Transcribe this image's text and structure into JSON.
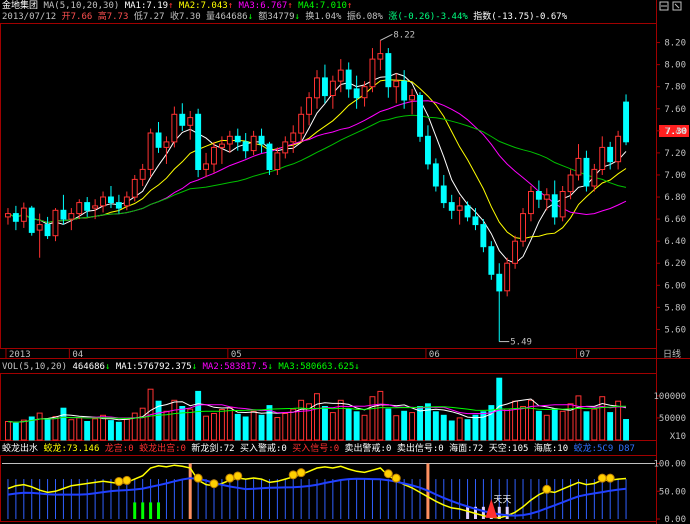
{
  "stock": {
    "name": "金地集团",
    "ma_label": "MA(5,10,20,30)",
    "ma1": "MA1:7.19",
    "ma2": "MA2:7.043",
    "ma3": "MA3:6.767",
    "ma4": "MA4:7.010"
  },
  "quote": {
    "date": "2013/07/12",
    "open": "开7.66",
    "high": "高7.73",
    "low": "低7.27",
    "close": "收7.30",
    "volume": "量464686",
    "amount": "额34779",
    "turnover": "换1.04%",
    "amplitude": "振6.08%",
    "change": "涨(-0.26)-3.44%",
    "index": "指数(-13.75)-0.67%"
  },
  "price_axis": {
    "ticks": [
      "8.20",
      "8.00",
      "7.80",
      "7.60",
      "7.40",
      "7.20",
      "7.00",
      "6.80",
      "6.60",
      "6.40",
      "6.20",
      "6.00",
      "5.80",
      "5.60"
    ],
    "current": "7.30",
    "high_marker": "8.22",
    "low_marker": "5.49"
  },
  "date_axis": {
    "labels": [
      "2013",
      "04",
      "05",
      "06",
      "07"
    ],
    "unit_label": "日线"
  },
  "volume_panel": {
    "title": "VOL(5,10,20)",
    "value": "464686",
    "ma1": "MA1:576792.375",
    "ma2": "MA2:583817.5",
    "ma3": "MA3:580663.625",
    "ticks": [
      "100000",
      "50000",
      "X10"
    ]
  },
  "indicator_panel": {
    "name": "蛟龙出水",
    "jiaolong": "蛟龙:73.146",
    "longgong": "龙宫:0",
    "jiaolong_chugong": "蛟龙出宫:0",
    "xinlongjian": "新龙剑:72",
    "buy_warning": "买入警戒:0",
    "buy_signal": "买入信号:0",
    "sell_warning": "卖出警戒:0",
    "sell_signal": "卖出信号:0",
    "haimian": "海面:72",
    "tiankong": "天空:105",
    "haidi": "海底:10",
    "jiaolong2": "蛟龙:5C9 D87",
    "ticks": [
      "100.00",
      "50.00",
      "0.00"
    ],
    "flag_text": "天天"
  },
  "chart_data": {
    "type": "candlestick",
    "ylim": [
      5.45,
      8.35
    ],
    "candles": [
      [
        6.62,
        6.7,
        6.55,
        6.65
      ],
      [
        6.65,
        6.72,
        6.5,
        6.58
      ],
      [
        6.58,
        6.75,
        6.52,
        6.7
      ],
      [
        6.7,
        6.72,
        6.45,
        6.48
      ],
      [
        6.5,
        6.65,
        6.25,
        6.55
      ],
      [
        6.55,
        6.62,
        6.42,
        6.45
      ],
      [
        6.45,
        6.7,
        6.4,
        6.68
      ],
      [
        6.68,
        6.82,
        6.55,
        6.6
      ],
      [
        6.6,
        6.7,
        6.5,
        6.65
      ],
      [
        6.65,
        6.78,
        6.6,
        6.75
      ],
      [
        6.75,
        6.8,
        6.62,
        6.68
      ],
      [
        6.7,
        6.78,
        6.6,
        6.72
      ],
      [
        6.72,
        6.85,
        6.66,
        6.8
      ],
      [
        6.8,
        6.9,
        6.7,
        6.75
      ],
      [
        6.75,
        6.82,
        6.65,
        6.7
      ],
      [
        6.72,
        6.85,
        6.68,
        6.8
      ],
      [
        6.8,
        7.0,
        6.76,
        6.96
      ],
      [
        6.96,
        7.1,
        6.9,
        7.05
      ],
      [
        7.05,
        7.42,
        6.98,
        7.38
      ],
      [
        7.38,
        7.48,
        7.2,
        7.25
      ],
      [
        7.25,
        7.35,
        7.1,
        7.3
      ],
      [
        7.3,
        7.62,
        7.25,
        7.55
      ],
      [
        7.55,
        7.65,
        7.4,
        7.45
      ],
      [
        7.45,
        7.58,
        7.32,
        7.52
      ],
      [
        7.55,
        7.6,
        6.98,
        7.05
      ],
      [
        7.05,
        7.2,
        6.98,
        7.1
      ],
      [
        7.1,
        7.3,
        7.02,
        7.25
      ],
      [
        7.25,
        7.35,
        7.1,
        7.28
      ],
      [
        7.28,
        7.4,
        7.2,
        7.35
      ],
      [
        7.35,
        7.42,
        7.22,
        7.3
      ],
      [
        7.3,
        7.38,
        7.15,
        7.22
      ],
      [
        7.22,
        7.4,
        7.18,
        7.35
      ],
      [
        7.35,
        7.42,
        7.2,
        7.28
      ],
      [
        7.28,
        7.3,
        7.0,
        7.05
      ],
      [
        7.05,
        7.25,
        7.0,
        7.2
      ],
      [
        7.2,
        7.35,
        7.15,
        7.3
      ],
      [
        7.3,
        7.45,
        7.2,
        7.38
      ],
      [
        7.38,
        7.62,
        7.3,
        7.55
      ],
      [
        7.55,
        7.75,
        7.45,
        7.7
      ],
      [
        7.7,
        7.95,
        7.6,
        7.88
      ],
      [
        7.88,
        8.0,
        7.65,
        7.72
      ],
      [
        7.72,
        7.9,
        7.6,
        7.85
      ],
      [
        7.85,
        8.05,
        7.75,
        7.95
      ],
      [
        7.95,
        8.02,
        7.7,
        7.78
      ],
      [
        7.78,
        7.9,
        7.6,
        7.7
      ],
      [
        7.7,
        7.85,
        7.62,
        7.8
      ],
      [
        7.8,
        8.15,
        7.75,
        8.05
      ],
      [
        8.05,
        8.22,
        7.95,
        8.1
      ],
      [
        8.1,
        8.15,
        7.7,
        7.8
      ],
      [
        7.8,
        7.92,
        7.65,
        7.85
      ],
      [
        7.85,
        7.95,
        7.6,
        7.68
      ],
      [
        7.68,
        7.78,
        7.55,
        7.72
      ],
      [
        7.72,
        7.75,
        7.3,
        7.35
      ],
      [
        7.35,
        7.45,
        7.05,
        7.1
      ],
      [
        7.1,
        7.15,
        6.85,
        6.9
      ],
      [
        6.9,
        7.0,
        6.7,
        6.75
      ],
      [
        6.75,
        6.82,
        6.6,
        6.68
      ],
      [
        6.68,
        6.8,
        6.55,
        6.72
      ],
      [
        6.72,
        6.76,
        6.58,
        6.62
      ],
      [
        6.62,
        6.7,
        6.5,
        6.55
      ],
      [
        6.55,
        6.6,
        6.3,
        6.35
      ],
      [
        6.35,
        6.4,
        6.05,
        6.1
      ],
      [
        6.1,
        6.2,
        5.49,
        5.95
      ],
      [
        5.95,
        6.25,
        5.9,
        6.2
      ],
      [
        6.2,
        6.45,
        6.15,
        6.4
      ],
      [
        6.4,
        6.7,
        6.35,
        6.65
      ],
      [
        6.65,
        6.9,
        6.58,
        6.85
      ],
      [
        6.85,
        6.95,
        6.7,
        6.78
      ],
      [
        6.78,
        6.88,
        6.68,
        6.82
      ],
      [
        6.82,
        6.95,
        6.55,
        6.62
      ],
      [
        6.62,
        6.9,
        6.58,
        6.85
      ],
      [
        6.85,
        7.05,
        6.78,
        7.0
      ],
      [
        7.0,
        7.28,
        6.95,
        7.15
      ],
      [
        7.15,
        7.22,
        6.85,
        6.9
      ],
      [
        6.9,
        7.1,
        6.85,
        7.05
      ],
      [
        7.05,
        7.35,
        7.0,
        7.25
      ],
      [
        7.25,
        7.3,
        7.05,
        7.12
      ],
      [
        7.12,
        7.4,
        7.05,
        7.35
      ],
      [
        7.66,
        7.73,
        7.27,
        7.3
      ]
    ],
    "volume": [
      420000,
      380000,
      450000,
      520000,
      610000,
      480000,
      530000,
      720000,
      460000,
      500000,
      420000,
      480000,
      560000,
      440000,
      400000,
      470000,
      610000,
      720000,
      1150000,
      880000,
      650000,
      900000,
      760000,
      700000,
      1100000,
      540000,
      600000,
      690000,
      730000,
      580000,
      520000,
      650000,
      560000,
      780000,
      510000,
      600000,
      700000,
      900000,
      820000,
      1050000,
      760000,
      620000,
      900000,
      700000,
      640000,
      560000,
      980000,
      1100000,
      700000,
      550000,
      650000,
      620000,
      760000,
      820000,
      640000,
      560000,
      430000,
      500000,
      460000,
      560000,
      640000,
      780000,
      1400000,
      700000,
      880000,
      760000,
      900000,
      650000,
      560000,
      700000,
      650000,
      820000,
      1000000,
      640000,
      700000,
      980000,
      620000,
      880000,
      464686
    ],
    "indicator": [
      55,
      60,
      62,
      58,
      52,
      48,
      50,
      55,
      60,
      62,
      64,
      66,
      68,
      66,
      64,
      66,
      72,
      78,
      92,
      96,
      94,
      97,
      95,
      92,
      70,
      62,
      60,
      64,
      70,
      74,
      72,
      74,
      72,
      66,
      68,
      72,
      76,
      80,
      86,
      92,
      94,
      92,
      95,
      90,
      86,
      84,
      88,
      92,
      78,
      70,
      62,
      56,
      48,
      40,
      32,
      25,
      20,
      18,
      14,
      10,
      6,
      3,
      2,
      6,
      12,
      22,
      34,
      44,
      50,
      48,
      54,
      60,
      66,
      62,
      64,
      70,
      70,
      72,
      73
    ]
  }
}
